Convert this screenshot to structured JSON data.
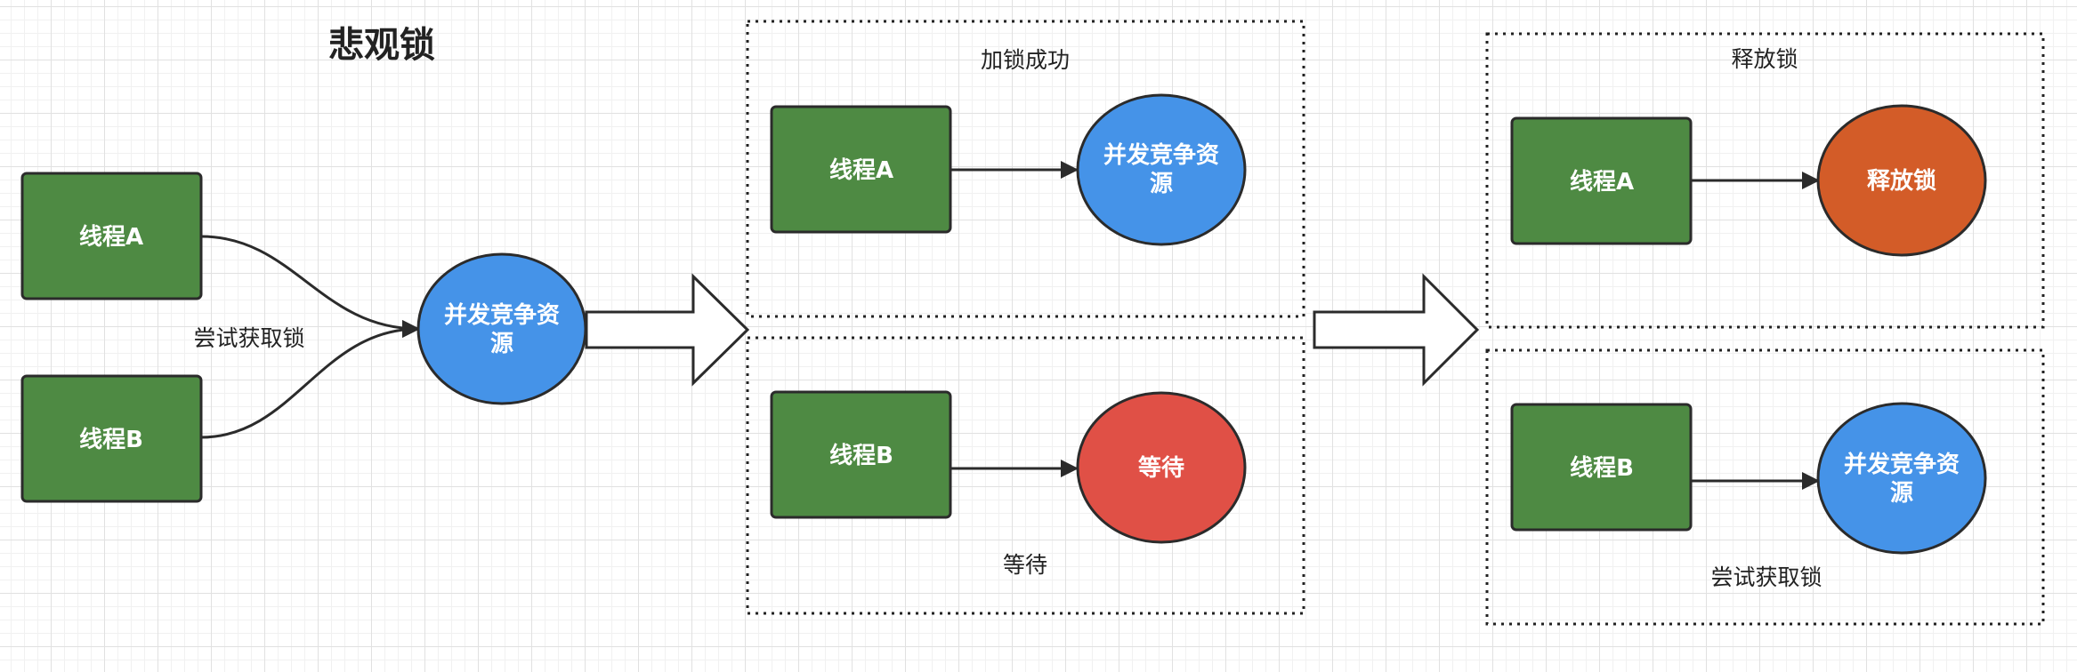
{
  "title": "悲观锁",
  "colors": {
    "thread_green": "#4e8a43",
    "resource_blue": "#4593e8",
    "release_orange": "#d35c28",
    "wait_red": "#e05046",
    "stroke": "#2b2b2b"
  },
  "stage1": {
    "thread_a": "线程A",
    "thread_b": "线程B",
    "edge_label": "尝试获取锁",
    "resource": [
      "并发竞争资",
      "源"
    ]
  },
  "group_lock_success": {
    "title": "加锁成功",
    "thread": "线程A",
    "resource": [
      "并发竞争资",
      "源"
    ]
  },
  "group_wait": {
    "caption": "等待",
    "thread": "线程B",
    "state": "等待"
  },
  "group_release": {
    "title": "释放锁",
    "thread": "线程A",
    "state": "释放锁"
  },
  "group_retry": {
    "caption": "尝试获取锁",
    "thread": "线程B",
    "resource": [
      "并发竞争资",
      "源"
    ]
  }
}
